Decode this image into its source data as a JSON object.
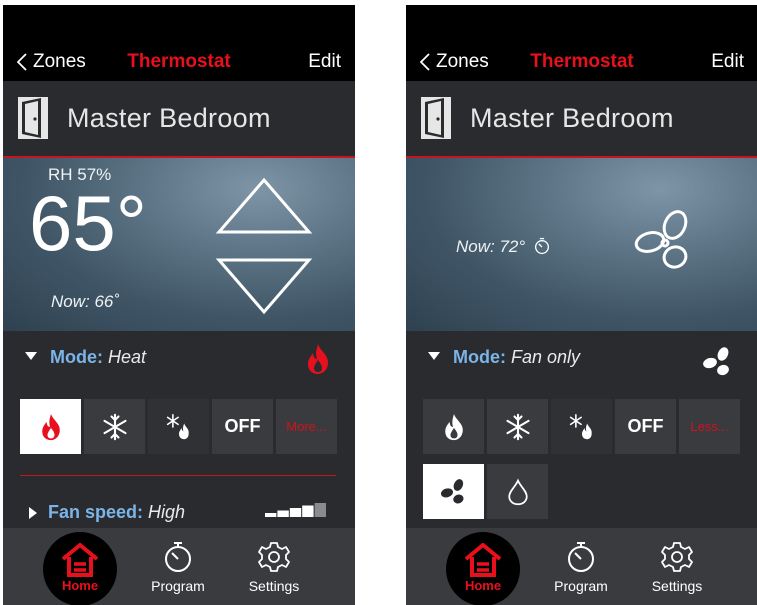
{
  "colors": {
    "accent_red": "#e8101d",
    "mode_blue": "#7bb4e6",
    "bar_black": "#000000",
    "panel": "#2a2b2f",
    "button": "#3a3b3f"
  },
  "left": {
    "nav": {
      "back_label": "Zones",
      "title": "Thermostat",
      "edit_label": "Edit"
    },
    "zone": {
      "name": "Master Bedroom",
      "icon": "door-icon"
    },
    "hero": {
      "humidity": "RH 57%",
      "setpoint": "65°",
      "now": "Now: 66˚"
    },
    "mode": {
      "label": "Mode:",
      "value": "Heat",
      "status_icon": "flame-icon"
    },
    "mode_buttons": [
      {
        "icon": "flame-icon",
        "selected": true
      },
      {
        "icon": "snowflake-icon"
      },
      {
        "icon": "snowflake-flame-icon"
      },
      {
        "label": "OFF"
      },
      {
        "label": "More..."
      }
    ],
    "fan": {
      "label": "Fan speed:",
      "value": "High",
      "level": 4,
      "level_max": 5
    },
    "tabs": {
      "home": "Home",
      "program": "Program",
      "settings": "Settings"
    }
  },
  "right": {
    "nav": {
      "back_label": "Zones",
      "title": "Thermostat",
      "edit_label": "Edit"
    },
    "zone": {
      "name": "Master Bedroom",
      "icon": "door-icon"
    },
    "hero": {
      "now": "Now: 72°",
      "now_icon": "timer-icon",
      "big_icon": "fan-icon"
    },
    "mode": {
      "label": "Mode:",
      "value": "Fan only",
      "status_icon": "fan-icon"
    },
    "mode_buttons": [
      {
        "icon": "flame-icon"
      },
      {
        "icon": "snowflake-icon"
      },
      {
        "icon": "snowflake-flame-icon"
      },
      {
        "label": "OFF"
      },
      {
        "label": "Less..."
      }
    ],
    "extra_buttons": [
      {
        "icon": "fan-icon",
        "selected": true
      },
      {
        "icon": "droplet-icon"
      }
    ],
    "tabs": {
      "home": "Home",
      "program": "Program",
      "settings": "Settings"
    }
  }
}
